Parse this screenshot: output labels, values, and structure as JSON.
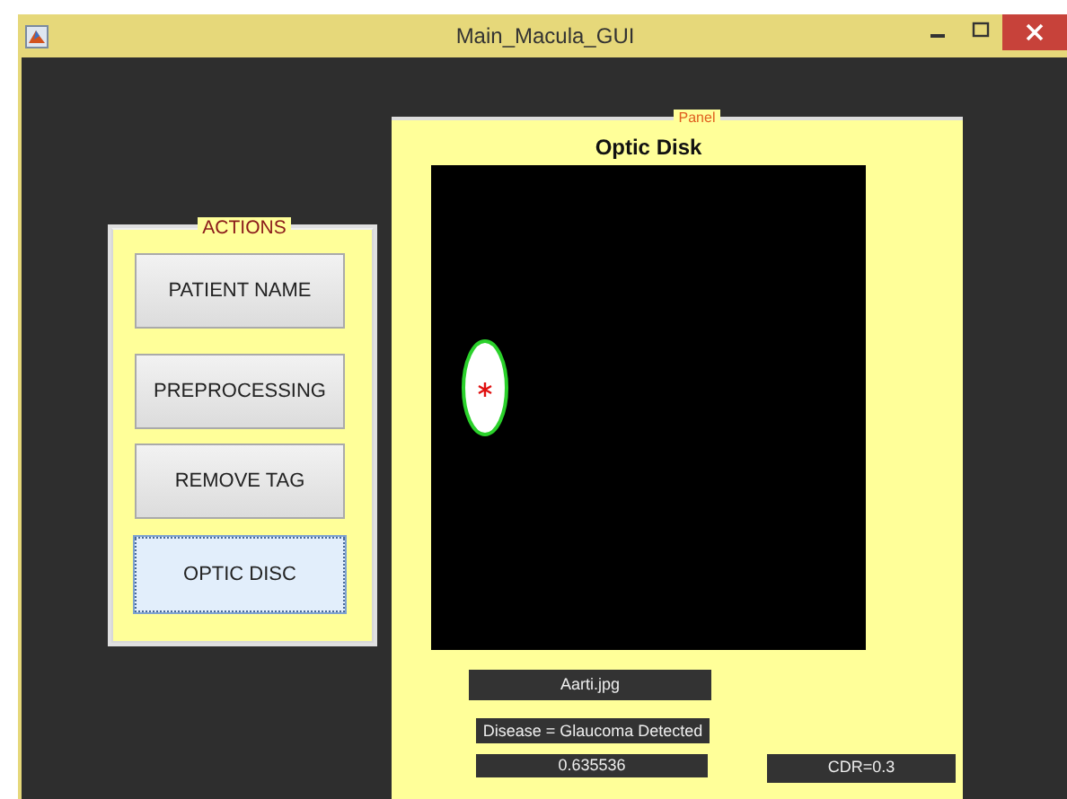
{
  "window": {
    "title": "Main_Macula_GUI"
  },
  "actions": {
    "title": "ACTIONS",
    "buttons": [
      {
        "label": "PATIENT NAME",
        "focused": false
      },
      {
        "label": "PREPROCESSING",
        "focused": false
      },
      {
        "label": "REMOVE TAG",
        "focused": false
      },
      {
        "label": "OPTIC DISC",
        "focused": true
      }
    ]
  },
  "panel": {
    "title": "Panel",
    "axes_title": "Optic Disk",
    "file_name": "Aarti.jpg",
    "diagnosis": "Disease = Glaucoma Detected",
    "value": "0.635536",
    "cdr": "CDR=0.3"
  }
}
